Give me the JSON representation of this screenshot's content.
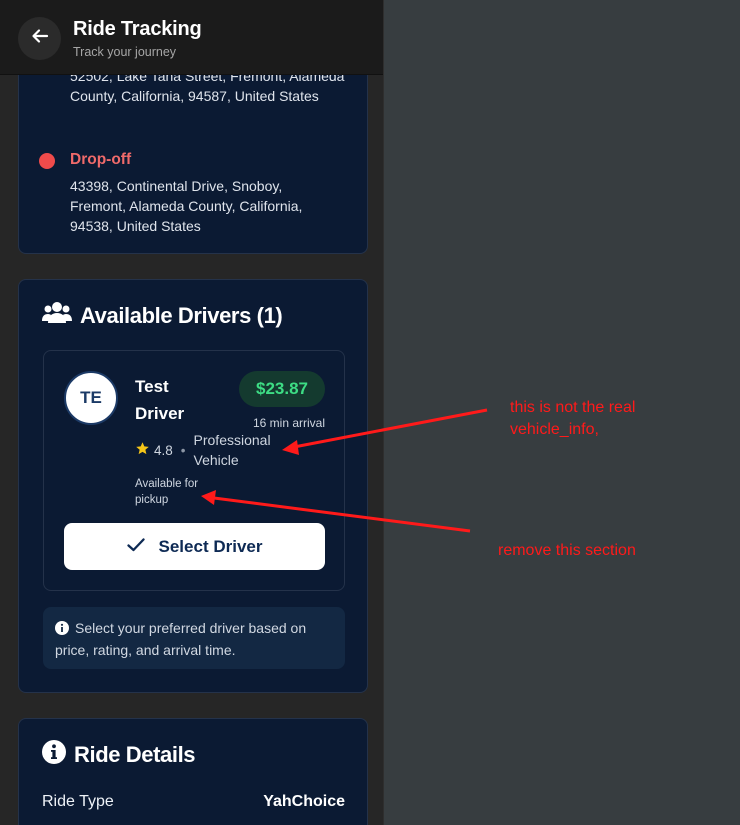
{
  "header": {
    "title": "Ride Tracking",
    "subtitle": "Track your journey"
  },
  "locations": {
    "pickup_address": "52502, Lake Tana Street, Fremont, Alameda County, California, 94587, United States",
    "dropoff_label": "Drop-off",
    "dropoff_address": "43398, Continental Drive, Snoboy, Fremont, Alameda County, California, 94538, United States"
  },
  "drivers": {
    "title": "Available Drivers (1)",
    "list": [
      {
        "initials": "TE",
        "name": "Test Driver",
        "price": "$23.87",
        "arrival": "16 min arrival",
        "rating": "4.8",
        "separator": "•",
        "vehicle": "Professional Vehicle",
        "availability": "Available for pickup",
        "select_label": "Select Driver"
      }
    ],
    "info_text": "Select your preferred driver based on price, rating, and arrival time."
  },
  "ride_details": {
    "title": "Ride Details",
    "ride_type_label": "Ride Type",
    "ride_type_value": "YahChoice"
  },
  "annotations": {
    "note_vehicle": "this is not the real vehicle_info,",
    "note_remove": "remove this section"
  },
  "colors": {
    "card_bg": "#0b1a33",
    "price_green": "#3ddc84",
    "dropoff_red": "#ef4b4b",
    "annotation_red": "#ff1a1a"
  },
  "icons": {
    "back": "arrow-left-icon",
    "drivers": "users-icon",
    "rating": "star-icon",
    "select": "check-icon",
    "info": "info-icon",
    "details": "info-circle-icon"
  }
}
